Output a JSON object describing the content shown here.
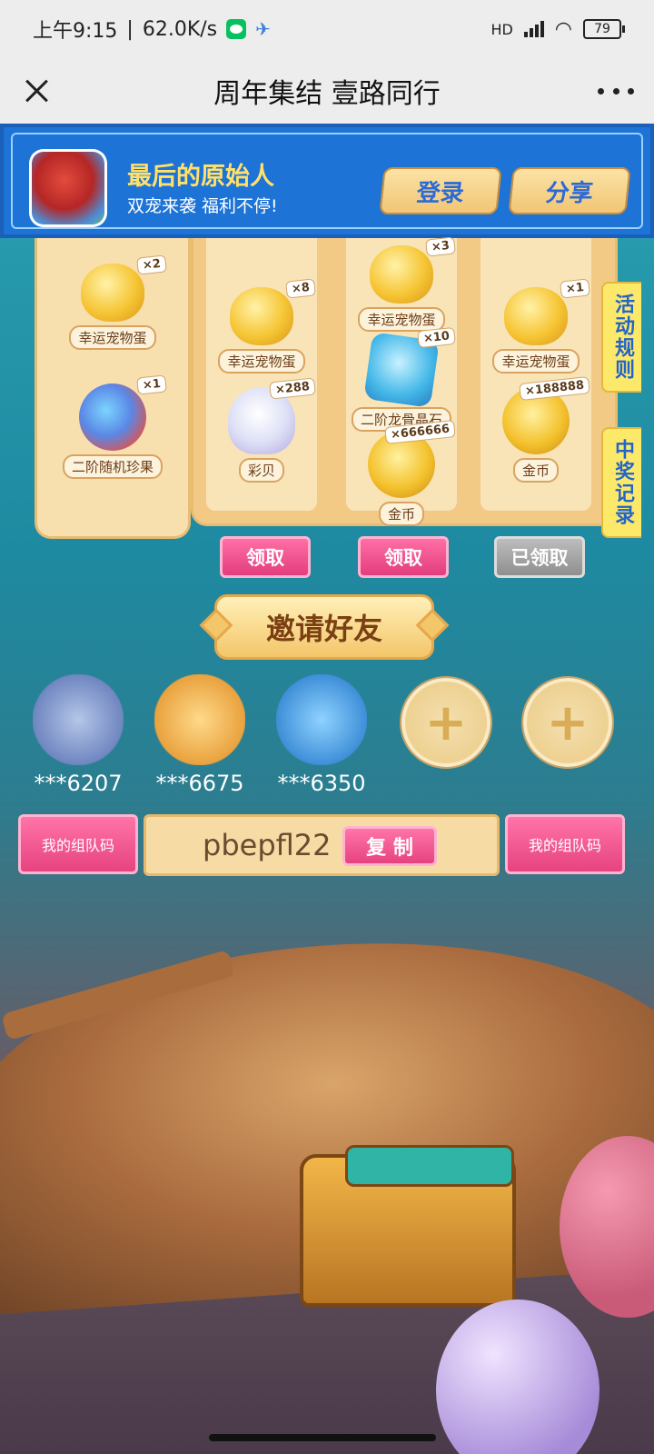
{
  "status_bar": {
    "time": "上午9:15",
    "net_speed": "62.0K/s",
    "network": "HD",
    "battery": "79"
  },
  "title_bar": {
    "title": "周年集结 壹路同行"
  },
  "banner": {
    "game_name": "最后的原始人",
    "slogan": "双宠来袭 福利不停!",
    "login_label": "登录",
    "share_label": "分享"
  },
  "side_tabs": {
    "rules": "活动规则",
    "records": "中奖记录"
  },
  "rewards": {
    "left": [
      {
        "label": "幸运宠物蛋",
        "qty": "×2",
        "icon": "egg-icon"
      },
      {
        "label": "二阶随机珍果",
        "qty": "×1",
        "icon": "fruit-icon"
      }
    ],
    "col1": [
      {
        "label": "幸运宠物蛋",
        "qty": "×8",
        "icon": "egg-icon"
      },
      {
        "label": "彩贝",
        "qty": "×288",
        "icon": "shell-icon"
      }
    ],
    "col2": [
      {
        "label": "幸运宠物蛋",
        "qty": "×3",
        "icon": "egg-icon"
      },
      {
        "label": "二阶龙骨晶石",
        "qty": "×10",
        "icon": "crystal-icon"
      },
      {
        "label": "金币",
        "qty": "×666666",
        "icon": "coin-icon"
      }
    ],
    "col3": [
      {
        "label": "幸运宠物蛋",
        "qty": "×1",
        "icon": "egg-icon"
      },
      {
        "label": "金币",
        "qty": "×188888",
        "icon": "coin-icon"
      }
    ]
  },
  "claim_buttons": [
    {
      "label": "领取",
      "state": "active"
    },
    {
      "label": "领取",
      "state": "active"
    },
    {
      "label": "已领取",
      "state": "done"
    }
  ],
  "invite": {
    "title": "邀请好友",
    "friends": [
      {
        "name": "***6207"
      },
      {
        "name": "***6675"
      },
      {
        "name": "***6350"
      }
    ],
    "add_slot_symbol": "+"
  },
  "team": {
    "label_left": "我的组队码",
    "label_right": "我的组队码",
    "code": "pbepfl22",
    "copy_label": "复 制"
  },
  "colors": {
    "banner_blue": "#1d73d6",
    "pink_button": "#e33d7e",
    "gold_text": "#ffe16a"
  }
}
